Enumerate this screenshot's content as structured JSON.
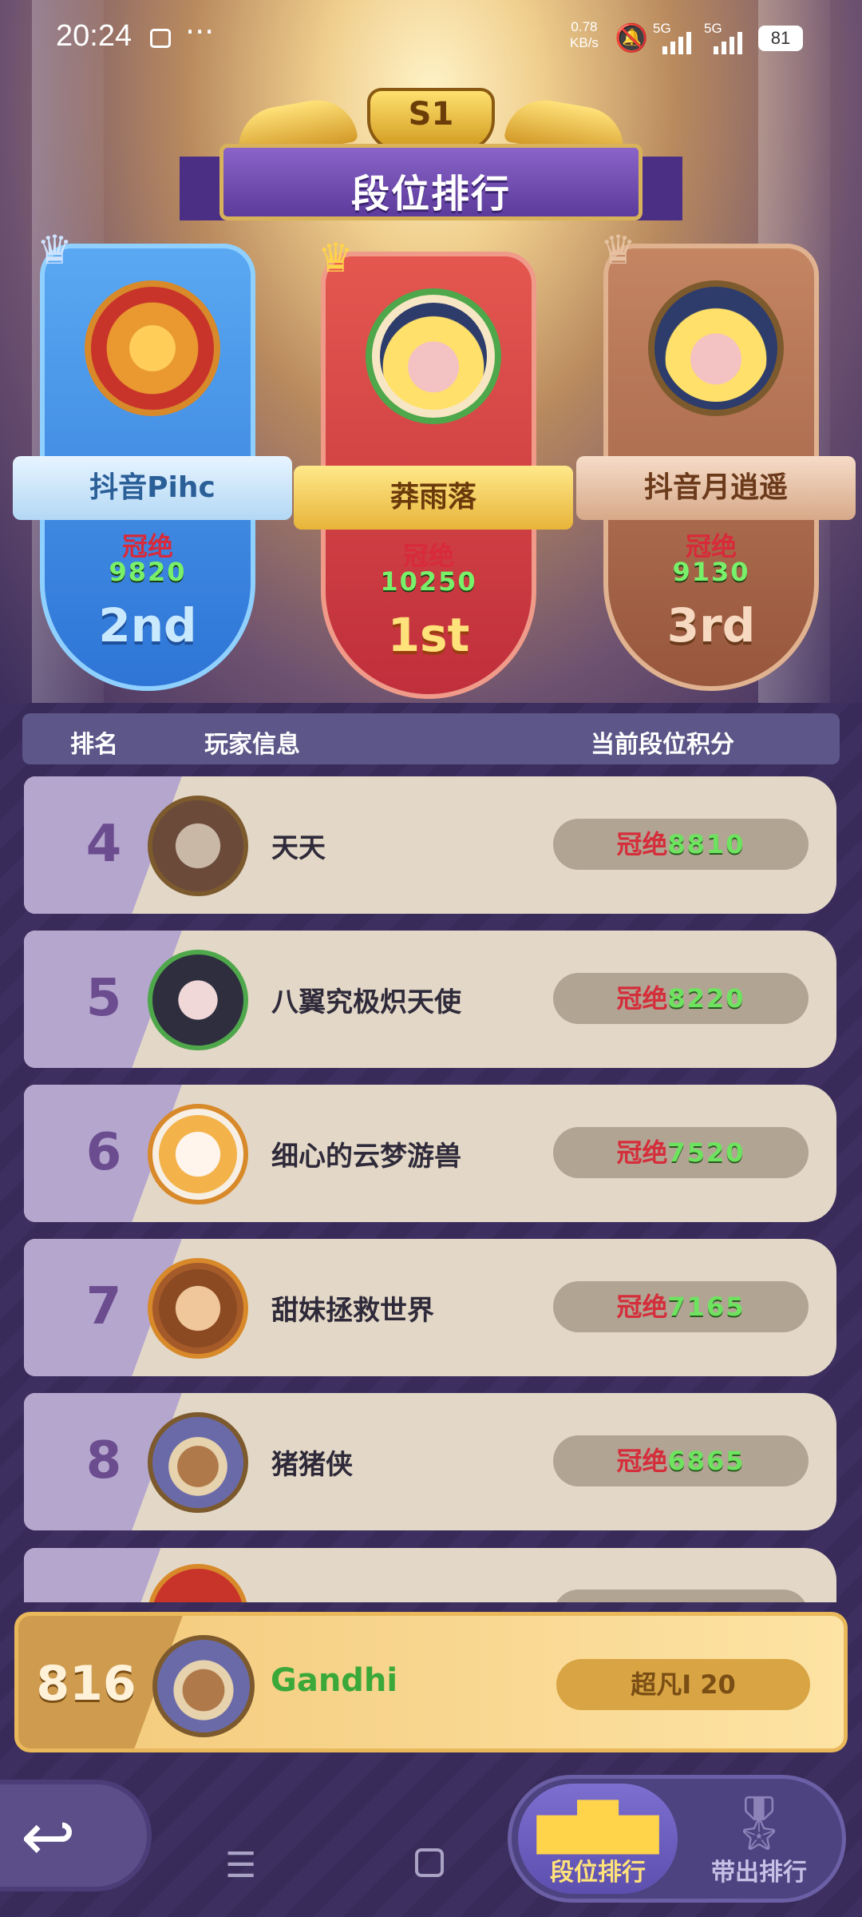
{
  "status_bar": {
    "time": "20:24",
    "net_speed_value": "0.78",
    "net_speed_unit": "KB/s",
    "signal_1": "5G",
    "signal_2": "5G",
    "battery": "81"
  },
  "header": {
    "season": "S1",
    "title": "段位排行"
  },
  "podium": [
    {
      "place_label": "2nd",
      "name": "抖音Pihc",
      "tier": "冠绝",
      "score": "9820",
      "crown": "silver"
    },
    {
      "place_label": "1st",
      "name": "莽雨落",
      "tier": "冠绝",
      "score": "10250",
      "crown": "gold"
    },
    {
      "place_label": "3rd",
      "name": "抖音月逍遥",
      "tier": "冠绝",
      "score": "9130",
      "crown": "bronze"
    }
  ],
  "table": {
    "col_rank": "排名",
    "col_player": "玩家信息",
    "col_score": "当前段位积分",
    "rows": [
      {
        "rank": "4",
        "name": "天天",
        "tier": "冠绝",
        "score": "8810"
      },
      {
        "rank": "5",
        "name": "八翼究极炽天使",
        "tier": "冠绝",
        "score": "8220"
      },
      {
        "rank": "6",
        "name": "细心的云梦游兽",
        "tier": "冠绝",
        "score": "7520"
      },
      {
        "rank": "7",
        "name": "甜妹拯救世界",
        "tier": "冠绝",
        "score": "7165"
      },
      {
        "rank": "8",
        "name": "猪猪侠",
        "tier": "冠绝",
        "score": "6865"
      }
    ]
  },
  "my_rank": {
    "rank": "816",
    "name": "Gandhi",
    "score_text": "超凡I 20"
  },
  "tabs": [
    {
      "label": "段位排行",
      "active": true
    },
    {
      "label": "带出排行",
      "active": false
    }
  ],
  "colors": {
    "accent_purple": "#5d5789",
    "score_green": "#6ee35f",
    "tier_red": "#d52e3b",
    "gold": "#f3c97a"
  }
}
